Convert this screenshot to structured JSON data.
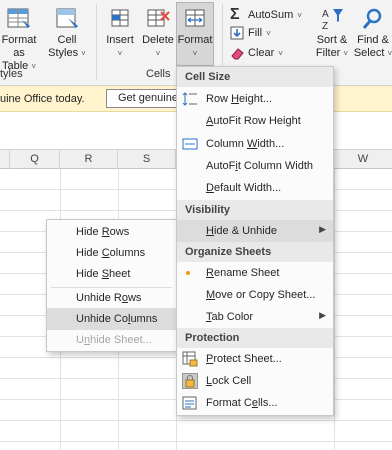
{
  "ribbon": {
    "format_as_table": {
      "line1": "Format as",
      "line2": "Table"
    },
    "cell_styles": {
      "line1": "Cell",
      "line2": "Styles"
    },
    "styles_group": "tyles",
    "insert": "Insert",
    "delete": "Delete",
    "format": "Format",
    "cells_group": "Cells",
    "autosum": "AutoSum",
    "fill": "Fill",
    "clear": "Clear",
    "sort_filter": {
      "line1": "Sort &",
      "line2": "Filter"
    },
    "find_select": {
      "line1": "Find &",
      "line2": "Select"
    }
  },
  "message_bar": {
    "text": "uine Office today.",
    "button": "Get genuine"
  },
  "columns": [
    "Q",
    "R",
    "S",
    "W"
  ],
  "format_menu": {
    "cell_size_header": "Cell Size",
    "row_height": {
      "pre": "Row ",
      "ul": "H",
      "post": "eight..."
    },
    "autofit_row_height": {
      "pre": "",
      "ul": "A",
      "post": "utoFit Row Height"
    },
    "column_width": {
      "pre": "Column ",
      "ul": "W",
      "post": "idth..."
    },
    "autofit_column_width": {
      "pre": "AutoF",
      "ul": "i",
      "post": "t Column Width"
    },
    "default_width": {
      "pre": "",
      "ul": "D",
      "post": "efault Width..."
    },
    "visibility_header": "Visibility",
    "hide_unhide": {
      "pre": "",
      "ul": "H",
      "post": "ide & Unhide"
    },
    "organize_header": "Organize Sheets",
    "rename_sheet": {
      "pre": "",
      "ul": "R",
      "post": "ename Sheet"
    },
    "move_copy": {
      "pre": "",
      "ul": "M",
      "post": "ove or Copy Sheet..."
    },
    "tab_color": {
      "pre": "",
      "ul": "T",
      "post": "ab Color"
    },
    "protection_header": "Protection",
    "protect_sheet": {
      "pre": "",
      "ul": "P",
      "post": "rotect Sheet..."
    },
    "lock_cell": {
      "pre": "",
      "ul": "L",
      "post": "ock Cell"
    },
    "format_cells": {
      "pre": "Format C",
      "ul": "e",
      "post": "lls..."
    }
  },
  "submenu": {
    "hide_rows": {
      "pre": "Hide ",
      "ul": "R",
      "post": "ows"
    },
    "hide_columns": {
      "pre": "Hide ",
      "ul": "C",
      "post": "olumns"
    },
    "hide_sheet": {
      "pre": "Hide ",
      "ul": "S",
      "post": "heet"
    },
    "unhide_rows": {
      "pre": "Unhide R",
      "ul": "o",
      "post": "ws"
    },
    "unhide_columns": {
      "pre": "Unhide Co",
      "ul": "l",
      "post": "umns"
    },
    "unhide_sheet": {
      "pre": "U",
      "ul": "n",
      "post": "hide Sheet..."
    }
  },
  "colors": {
    "accent_blue": "#2b72c4",
    "message_bar": "#fff4ce",
    "active_item": "#dcdcdc",
    "bullet_orange": "#f39c12"
  },
  "icons": {
    "insert": "insert-cells-icon",
    "delete": "delete-cells-icon",
    "format": "format-cells-icon",
    "autosum": "sigma-icon",
    "fill": "fill-down-icon",
    "clear": "eraser-icon",
    "sort": "sort-az-icon",
    "find": "magnifier-icon"
  }
}
